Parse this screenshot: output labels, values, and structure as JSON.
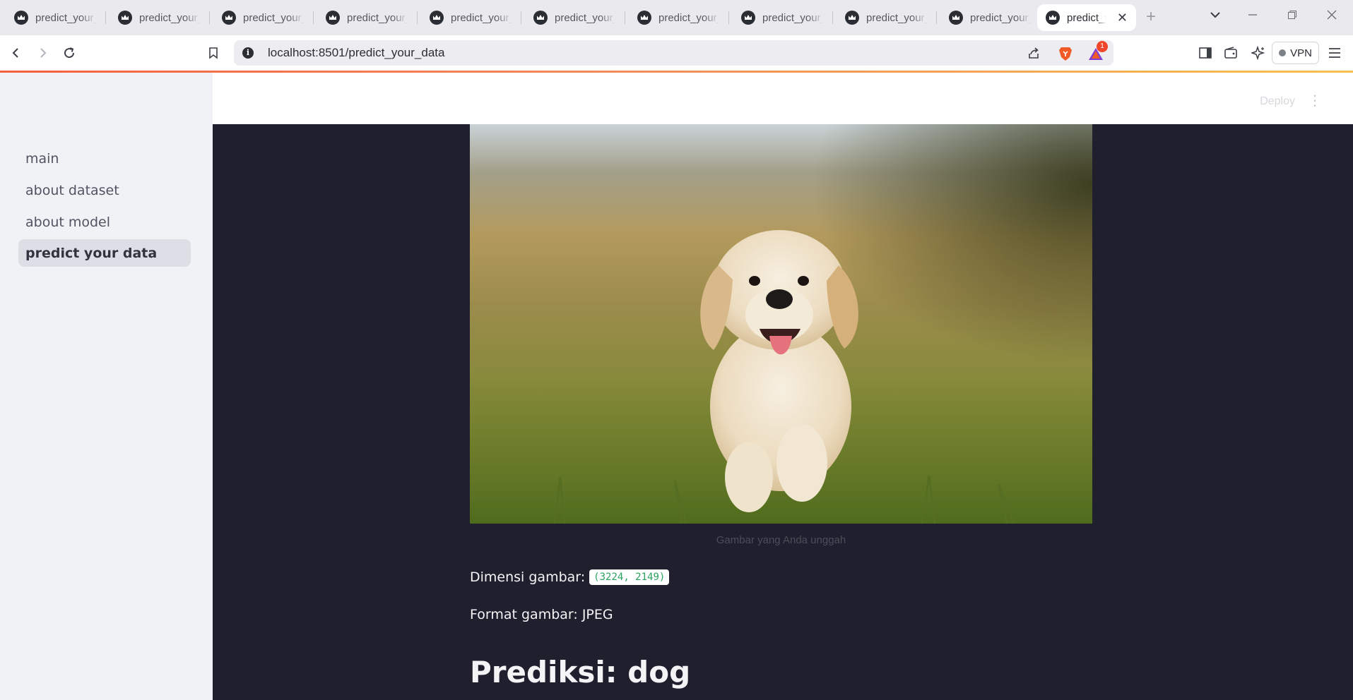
{
  "browser": {
    "tabs": [
      {
        "title": "predict_your_data"
      },
      {
        "title": "predict_your_data"
      },
      {
        "title": "predict_your_data"
      },
      {
        "title": "predict_your_data"
      },
      {
        "title": "predict_your_data"
      },
      {
        "title": "predict_your_data"
      },
      {
        "title": "predict_your_data"
      },
      {
        "title": "predict_your_data"
      },
      {
        "title": "predict_your_data"
      },
      {
        "title": "predict_your_data"
      },
      {
        "title": "predict_your_data"
      }
    ],
    "url": "localhost:8501/predict_your_data",
    "vpn_label": "VPN",
    "notification_count": "1"
  },
  "sidebar": {
    "items": [
      {
        "label": "main"
      },
      {
        "label": "about dataset"
      },
      {
        "label": "about model"
      },
      {
        "label": "predict your data"
      }
    ],
    "active_index": 3
  },
  "header": {
    "deploy_label": "Deploy"
  },
  "main": {
    "image_caption": "Gambar yang Anda unggah",
    "dimension_label": "Dimensi gambar:",
    "dimension_value": "(3224, 2149)",
    "format_text": "Format gambar: JPEG",
    "prediction_text": "Prediksi: dog"
  },
  "colors": {
    "app_background": "#1f1f2d",
    "sidebar_background": "#f0f2f6",
    "code_text": "#2aa35f"
  }
}
